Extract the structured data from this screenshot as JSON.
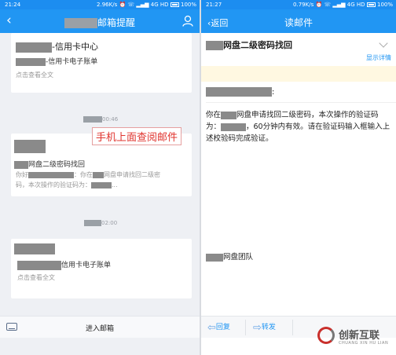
{
  "left": {
    "status": {
      "time": "21:24",
      "right": "2.96K/s ⏰ ☏ ▂▄▆ 4G HD",
      "battery": "100%"
    },
    "nav": {
      "back_icon": "‹",
      "title_suffix": "邮箱提醒"
    },
    "cards": [
      {
        "title": "-信用卡中心",
        "line": "-信用卡电子账单",
        "foot": "点击查看全文"
      },
      {
        "subject": "网盘二级密码找回",
        "preview_1a": "你好",
        "preview_1b": "：你在",
        "preview_1c": "网盘申请找回二级密",
        "preview_2a": "码，本次操作的验证码为：",
        "preview_2b": "..."
      },
      {
        "line": "信用卡电子账单",
        "foot": "点击查看全文"
      }
    ],
    "times": [
      "00:46",
      "02:00"
    ],
    "overlay_text": "手机上面查阅邮件",
    "bottom": {
      "label": "进入邮箱"
    }
  },
  "right": {
    "status": {
      "time": "21:27",
      "right": "0.79K/s ⏰ ☏ ▂▄▆ 4G HD",
      "battery": "100%"
    },
    "nav": {
      "back_label": "‹返回",
      "title": "读邮件"
    },
    "subject": "网盘二级密码找回",
    "details_link": "显示详情",
    "greeting_suffix": ":",
    "body": {
      "p1a": "你在",
      "p1b": "网盘申请找回二级密码，本次操作的验证码为：",
      "p1c": "，60分钟内有效。请在验证码输入框输入上述校验码完成验证。"
    },
    "signature": "网盘团队",
    "actions": {
      "reply": "回复",
      "forward": "转发"
    }
  },
  "logo": {
    "text": "创新互联",
    "sub": "CHUANG XIN HU LIAN"
  },
  "colors": {
    "accent": "#2196f3",
    "status_bar": "#1c8df0",
    "overlay_red": "#e0342e",
    "notice": "#fff8e1"
  },
  "icons": {
    "back": "chevron-left-icon",
    "contacts": "person-icon",
    "keyboard": "keyboard-icon",
    "reply": "reply-arrow-icon",
    "forward": "forward-arrow-icon",
    "expand": "chevron-down-icon"
  }
}
